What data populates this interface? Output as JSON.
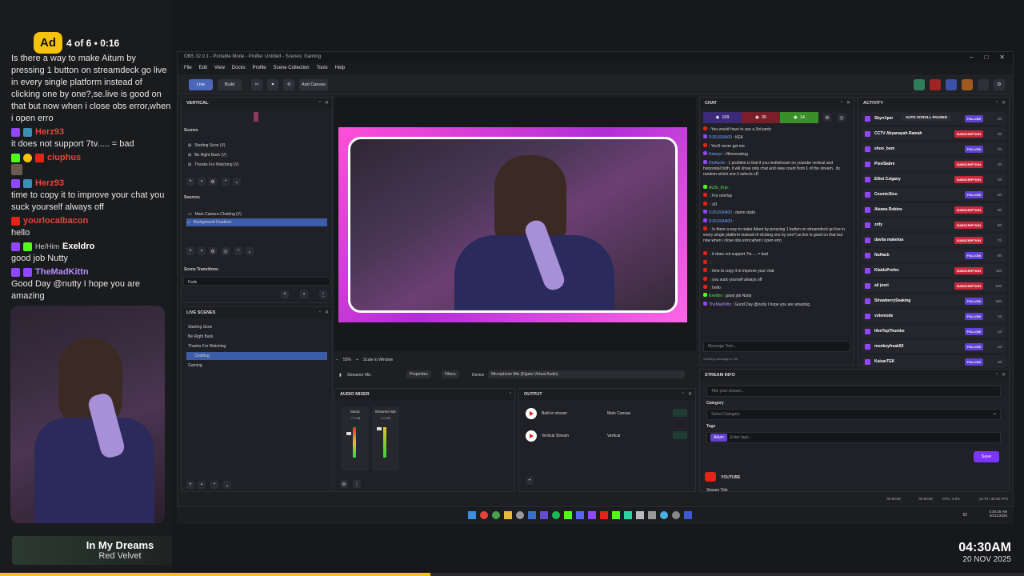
{
  "ad": {
    "badge": "Ad",
    "count": "4 of 6 • 0:16"
  },
  "chat_overlay": {
    "messages": [
      {
        "user": "",
        "text": "Is there a way to make Aitum by pressing 1 button on streamdeck go live in every single platform instead of clicking one by one?,se.live is good on that but now when i close obs error,when i open erro"
      },
      {
        "user": "Herz93",
        "text": "it does not support 7tv..... = bad"
      },
      {
        "user": "ciuphus",
        "text": ""
      },
      {
        "user": "Herz93",
        "text": "time to copy it to improve your chat you suck yourself always off"
      },
      {
        "user": "yourlocalbacon",
        "text": "hello"
      },
      {
        "user": "Exeldro",
        "pronoun": "He/Him",
        "text": "good job Nutty"
      },
      {
        "user": "TheMadKittn",
        "text": "Good Day @nutty I hope you are amazing"
      }
    ]
  },
  "song": {
    "title": "In My Dreams",
    "artist": "Red Velvet"
  },
  "progress_fraction": 0.42,
  "clock": {
    "time": "04:30AM",
    "date": "20 NOV 2025"
  },
  "obs": {
    "title": "OBS 32.0.1 - Portable Mode - Profile: Untitled - Scenes: Gaming",
    "menu": [
      "File",
      "Edit",
      "View",
      "Docks",
      "Profile",
      "Scene Collection",
      "Tools",
      "Help"
    ],
    "toolbar": {
      "live": "Live",
      "build": "Build",
      "add_canvas": "Add Canvas"
    },
    "vertical": {
      "title": "VERTICAL",
      "scenes_label": "Scenes",
      "scenes": [
        "Starting Soon (V)",
        "Be Right Back (V)",
        "Thanks For Watching (V)"
      ],
      "sources_label": "Sources",
      "sources": [
        "Main Camera Chatting (V)",
        "Background Gradient"
      ],
      "transitions_label": "Scene Transitions",
      "transition": "Fade"
    },
    "live_scenes": {
      "title": "LIVE SCENES",
      "items": [
        "Starting Soon",
        "Be Right Back",
        "Thanks For Watching",
        "Chatting",
        "Gaming"
      ]
    },
    "preview": {
      "zoom": "55%",
      "scale": "Scale to Window"
    },
    "source_bar": {
      "name": "Streamer Mic",
      "properties": "Properties",
      "filters": "Filters",
      "device_label": "Device",
      "device": "Microphone Mix (Elgato Virtual Audio)"
    },
    "audio_mixer": {
      "title": "AUDIO MIXER",
      "channels": [
        {
          "name": "Music",
          "db": "-7.0 dB"
        },
        {
          "name": "Streamer Mic",
          "db": "0.0 dB"
        }
      ]
    },
    "output": {
      "title": "OUTPUT",
      "rows": [
        {
          "name": "Built-in stream",
          "canvas": "Main Canvas"
        },
        {
          "name": "Vertical Stream",
          "canvas": "Vertical"
        }
      ]
    },
    "chat": {
      "title": "CHAT",
      "counts": {
        "youtube": "109",
        "twitch": "35",
        "kick": "14"
      },
      "messages": [
        {
          "u": "",
          "t": ": You would have to use a 3rd party",
          "c": "red"
        },
        {
          "u": "DJSUSAN00",
          "t": " : KEK",
          "c": "blue"
        },
        {
          "u": "",
          "t": ": You'll never get me",
          "c": "red"
        },
        {
          "u": "Kaeeyo",
          "t": " : #theresabug",
          "c": "blue"
        },
        {
          "u": "DivAardv",
          "t": " : 1 problem is that if you multistream on youtube vertical and horizontal both, it will show only chat and view count from 1 of the stream.. its random which one it selects xD",
          "c": "blue"
        },
        {
          "u": "AUSr_Krip",
          "t": " :",
          "c": "green"
        },
        {
          "u": "",
          "t": " : For overlay",
          "c": "red"
        },
        {
          "u": "",
          "t": " : xD",
          "c": "red"
        },
        {
          "u": "DJSUSAN00",
          "t": " : damn dude",
          "c": "blue"
        },
        {
          "u": "DJSUSAN00",
          "t": " :",
          "c": "blue"
        },
        {
          "u": "",
          "t": " : Is there a way to make Aitum by pressing 1 button on streamdeck go live in every single platform instead of clicking one by one?,se.live is good on that but now when i close obs error,when i open erro",
          "c": "red"
        },
        {
          "u": "",
          "t": " : it does not support 7tv..... = bad",
          "c": "red"
        },
        {
          "u": "",
          "t": " :",
          "c": "red"
        },
        {
          "u": "",
          "t": " : time to copy it to improve your chat",
          "c": "red"
        },
        {
          "u": "",
          "t": " : you suck yourself always off",
          "c": "red"
        },
        {
          "u": "",
          "t": " : hello",
          "c": "red"
        },
        {
          "u": "Exeldro",
          "t": " : good job Nutty",
          "c": "green"
        },
        {
          "u": "TheMadKittn",
          "t": " : Good Day @nutty I hope you are amazing",
          "c": "purple"
        }
      ],
      "input_placeholder": "Message Text...",
      "sending_to": "Sending message to: All"
    },
    "activity": {
      "title": "ACTIVITY",
      "auto_scroll": "AUTO SCROLL PAUSED",
      "rows": [
        {
          "name": "Skyrr1per",
          "badge": "FOLLOW",
          "time": "2h"
        },
        {
          "name": "CCTV Abyanayah Ramah",
          "badge": "SUBSCRIPTION",
          "time": "2h"
        },
        {
          "name": "shoo_bum",
          "badge": "FOLLOW",
          "time": "2h"
        },
        {
          "name": "PixelSabre",
          "badge": "SUBSCRIPTION",
          "time": "3h"
        },
        {
          "name": "Elliot Czigany",
          "badge": "SUBSCRIPTION",
          "time": "4h"
        },
        {
          "name": "CosmicSixu",
          "badge": "FOLLOW",
          "time": "5h"
        },
        {
          "name": "Aleana Robins",
          "badge": "SUBSCRIPTION",
          "time": "5h"
        },
        {
          "name": "zofy",
          "badge": "SUBSCRIPTION",
          "time": "6h"
        },
        {
          "name": "davita maketoa",
          "badge": "SUBSCRIPTION",
          "time": "7h"
        },
        {
          "name": "NuHack",
          "badge": "FOLLOW",
          "time": "8h"
        },
        {
          "name": "KlaiduProfex",
          "badge": "SUBSCRIPTION",
          "time": "11h"
        },
        {
          "name": "ali joori",
          "badge": "SUBSCRIPTION",
          "time": "12h"
        },
        {
          "name": "StrawberrySeaking",
          "badge": "FOLLOW",
          "time": "16h"
        },
        {
          "name": "volemode",
          "badge": "FOLLOW",
          "time": "1d"
        },
        {
          "name": "IAmTopThumbs",
          "badge": "FOLLOW",
          "time": "1d"
        },
        {
          "name": "monkeyfreak93",
          "badge": "FOLLOW",
          "time": "2d"
        },
        {
          "name": "KaisarTEK",
          "badge": "FOLLOW",
          "time": "3d"
        }
      ]
    },
    "stream_info": {
      "title": "STREAM INFO",
      "title_placeholder": "Title your stream...",
      "category_label": "Category",
      "category_placeholder": "Select Category",
      "tags_label": "Tags",
      "tag": "Aitum",
      "tags_placeholder": "Enter tags...",
      "save": "Save",
      "youtube_label": "YOUTUBE",
      "stream_title_label": "Stream Title"
    },
    "status": {
      "time1": "00:00:00",
      "time2": "00:00:00",
      "cpu": "CPU: 4.9%",
      "fps": "12.70 / 30.00 FPS"
    },
    "taskbar": {
      "clock_time": "4:30:28 AM",
      "clock_date": "20/11/2025",
      "battery": "62"
    }
  }
}
